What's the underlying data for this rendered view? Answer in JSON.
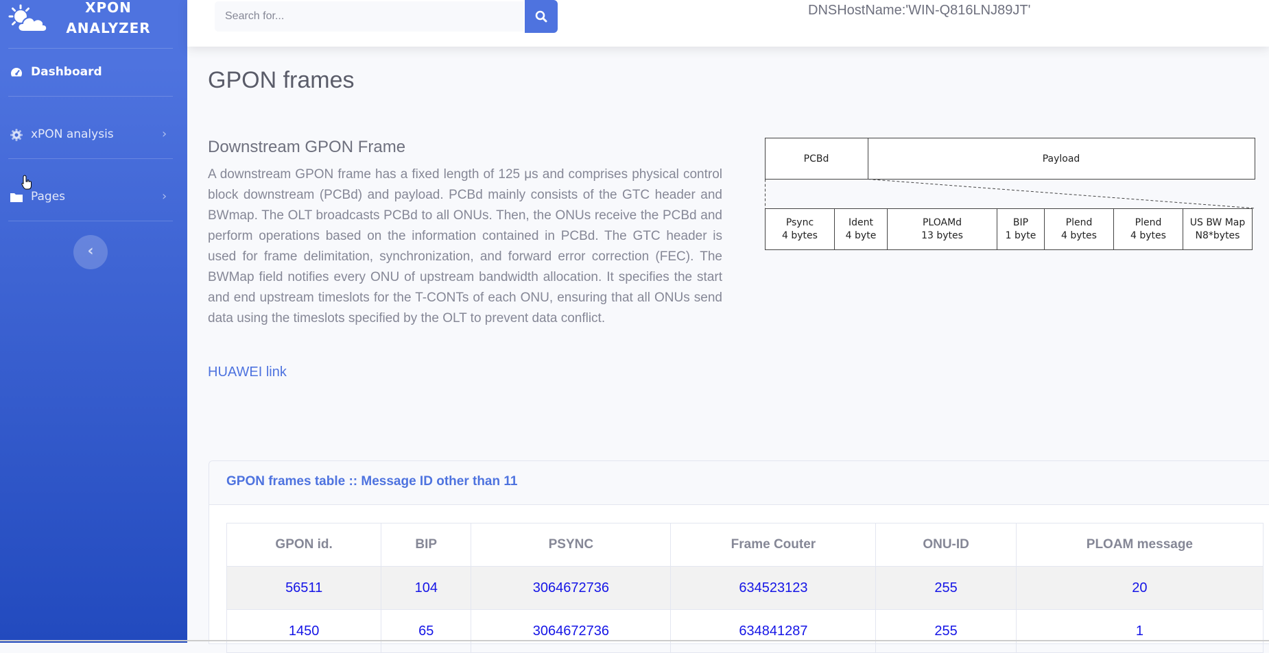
{
  "brand": {
    "line1": "XPON",
    "line2": "ANALYZER"
  },
  "sidebar": {
    "items": [
      {
        "label": "Dashboard",
        "icon": "tachometer-icon"
      },
      {
        "label": "xPON analysis",
        "icon": "gear-icon"
      },
      {
        "label": "Pages",
        "icon": "folder-icon"
      }
    ],
    "toggle_symbol": "‹"
  },
  "topbar": {
    "search_placeholder": "Search for...",
    "hostname": "DNSHostName:'WIN-Q816LNJ89JT'"
  },
  "main": {
    "page_title": "GPON frames",
    "section_title": "Downstream GPON Frame",
    "description": "A downstream GPON frame has a fixed length of 125 μs and comprises physical control block downstream (PCBd) and payload. PCBd mainly consists of the GTC header and BWmap. The OLT broadcasts PCBd to all ONUs. Then, the ONUs receive the PCBd and perform operations based on the information contained in PCBd. The GTC header is used for frame delimitation, synchronization, and forward error correction (FEC). The BWMap field notifies every ONU of upstream bandwidth allocation. It specifies the start and end upstream timeslots for the T-CONTs of each ONU, ensuring that all ONUs send data using the timeslots specified by the OLT to prevent data conflict.",
    "link_text": "HUAWEI link"
  },
  "diagram": {
    "top": {
      "pcbd": "PCBd",
      "payload": "Payload"
    },
    "fields": [
      {
        "name": "Psync",
        "size": "4 bytes"
      },
      {
        "name": "Ident",
        "size": "4 byte"
      },
      {
        "name": "PLOAMd",
        "size": "13 bytes"
      },
      {
        "name": "BIP",
        "size": "1 byte"
      },
      {
        "name": "Plend",
        "size": "4 bytes"
      },
      {
        "name": "Plend",
        "size": "4 bytes"
      },
      {
        "name": "US BW Map",
        "size": "N8*bytes"
      }
    ]
  },
  "table": {
    "title": "GPON frames table :: Message ID other than 11",
    "columns": [
      "GPON id.",
      "BIP",
      "PSYNC",
      "Frame Couter",
      "ONU-ID",
      "PLOAM message"
    ],
    "rows": [
      [
        "56511",
        "104",
        "3064672736",
        "634523123",
        "255",
        "20"
      ],
      [
        "1450",
        "65",
        "3064672736",
        "634841287",
        "255",
        "1"
      ]
    ]
  },
  "colors": {
    "sidebar_top": "#4e73df",
    "sidebar_bottom": "#224abe",
    "accent": "#4e73df",
    "table_value": "#1515e6"
  }
}
